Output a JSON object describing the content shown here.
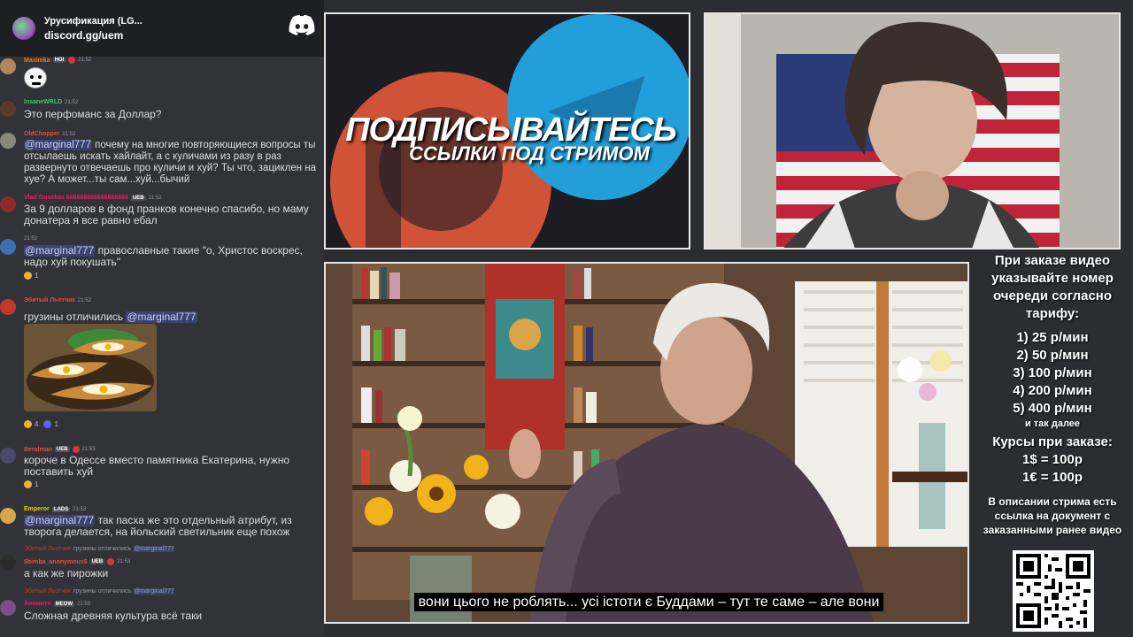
{
  "chat": {
    "server_name": "Урусификация (LG...",
    "server_link": "discord.gg/uem",
    "messages": [
      {
        "username": "Maximka",
        "badge": "HOI",
        "time": "21:52",
        "color": "#e67e22"
      },
      {
        "username": "InsaneWRLD",
        "time": "21:52",
        "text": "Это перфоманс за Доллар?",
        "color": "#2ecc71"
      },
      {
        "username": "OldChopper",
        "time": "21:52",
        "mention": "@marginal777",
        "text": " почему на многие повторяющиеся вопросы ты отсылаешь искать хайлайт, а с куличами из разу в раз развернуто отвечаешь про куличи и хуй? Ты что, зациклен на хуе? А может...ты сам...хуй...бычий",
        "color": "#e74c3c"
      },
      {
        "username": "Vlad Gusekas 666666666666666666",
        "badge": "UEB",
        "time": "21:52",
        "text": "За 9 долларов в фонд пранков конечно спасибо, но маму донатера я все равно ебал",
        "color": "#e91e63"
      },
      {
        "time": "21:52",
        "mention": "@marginal777",
        "text": " православные такие \"о, Христос воскрес, надо хуй покушать\"",
        "react_count": "1"
      },
      {
        "username": "Эбитый Льотчик",
        "time": "21:52",
        "text": "грузины отличились ",
        "mention": "@marginal777",
        "react1": "4",
        "react2": "1",
        "color": "#e74c3c"
      },
      {
        "username": "Beralman",
        "badge": "UEB",
        "time": "21:53",
        "text": "короче в Одессе вместо памятника Екатерина, нужно поставить хуй",
        "react_count": "1",
        "color": "#e74c3c"
      },
      {
        "username": "Emperor",
        "badge": "LADS",
        "time": "21:53",
        "mention": "@marginal777",
        "text": " так пасха же это отдельный атрибут, из творога делается, на йольский светильник еще похож",
        "color": "#f1c40f"
      },
      {
        "reply_name": "Эбитый Льотчик",
        "reply_text": "грузины отличились",
        "reply_mention": "@marginal777",
        "username": "$bimba_anonymous$",
        "badge": "UEB",
        "time": "21:53",
        "text": "а как же пирожки",
        "color": "#e74c3c"
      },
      {
        "reply_name": "Эбитый Льотчик",
        "reply_text": "грузины отличились",
        "reply_mention": "@marginal777",
        "username": "Анимнтн",
        "badge": "MEOW",
        "time": "21:53",
        "text": "Сложная древняя культура всё таки",
        "color": "#e91e63"
      }
    ]
  },
  "promo": {
    "title": "ПОДПИСЫВАЙТЕСЬ",
    "subtitle": "ССЫЛКИ ПОД СТРИМОМ"
  },
  "video": {
    "subtitle": "вони цього не роблять... усі істоти є Буддами – тут те саме – але вони"
  },
  "info": {
    "order_text": "При заказе видео указывайте номер очереди согласно тарифу:",
    "tariffs": [
      "1) 25 р/мин",
      "2) 50 р/мин",
      "3) 100 р/мин",
      "4) 200 р/мин",
      "5) 400 р/мин"
    ],
    "etc": "и так далее",
    "courses_title": "Курсы при заказе:",
    "rates": [
      "1$ = 100р",
      "1€ = 100р"
    ],
    "description": "В описании стрима есть ссылка на документ с заказанными ранее видео"
  }
}
